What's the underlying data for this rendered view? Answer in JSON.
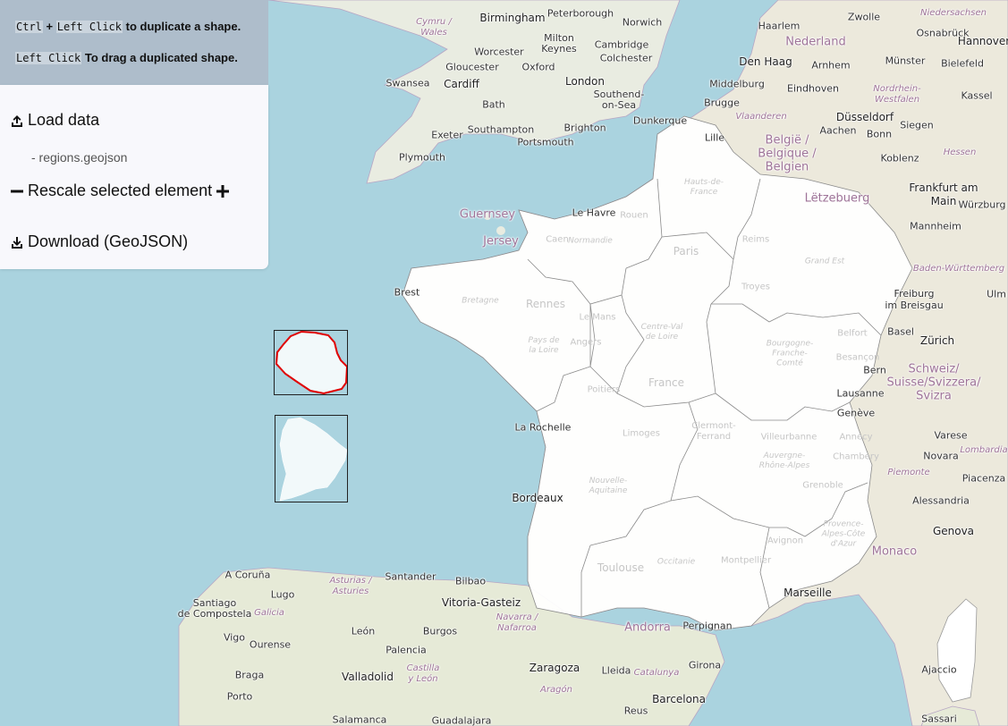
{
  "instructions": {
    "line1_key1": "Ctrl",
    "line1_plus": "+",
    "line1_key2": "Left Click",
    "line1_text": "to duplicate a shape.",
    "line2_key": "Left Click",
    "line2_text": "To drag a duplicated shape."
  },
  "panel": {
    "load_label": "Load data",
    "loaded_file": "- regions.geojson",
    "rescale_label": "Rescale selected element",
    "download_label": "Download (GeoJSON)"
  },
  "map": {
    "colors": {
      "sea": "#aad3df",
      "land": "#f1eee8",
      "overlay_fill": "#ffffff",
      "selected_stroke": "#e00000",
      "border": "#b7a6c4"
    },
    "country_labels": {
      "nederland": "Nederland",
      "belgie": "België /\nBelgique /\nBelgien",
      "letzebuerg": "Lëtzebuerg",
      "schweiz": "Schweiz/\nSuisse/Svizzera/\nSvizra",
      "andorra": "Andorra",
      "monaco": "Monaco"
    },
    "region_labels": {
      "cymru": "Cymru /\nWales",
      "vlaanderen": "Vlaanderen",
      "nordrhein": "Nordrhein-\nWestfalen",
      "hessen": "Hessen",
      "niedersachsen": "Niedersachsen",
      "baden": "Baden-Württemberg",
      "asturias": "Asturias /\nAsturies",
      "galicia": "Galicia",
      "navarra": "Navarra /\nNafarroa",
      "castilla": "Castilla\ny León",
      "catalunya": "Catalunya",
      "aragon": "Aragón",
      "piemonte": "Piemonte",
      "lombardia": "Lombardia"
    },
    "city_labels": {
      "birmingham": "Birmingham",
      "peterborough": "Peterborough",
      "norwich": "Norwich",
      "milton": "Milton\nKeynes",
      "cambridge": "Cambridge",
      "worcester": "Worcester",
      "colchester": "Colchester",
      "gloucester": "Gloucester",
      "oxford": "Oxford",
      "swansea": "Swansea",
      "cardiff": "Cardiff",
      "london": "London",
      "southend": "Southend-\non-Sea",
      "bath": "Bath",
      "exeter": "Exeter",
      "southampton": "Southampton",
      "brighton": "Brighton",
      "portsmouth": "Portsmouth",
      "plymouth": "Plymouth",
      "dunkerque": "Dunkerque",
      "guernsey": "Guernsey",
      "jersey": "Jersey",
      "lehavre": "Le Havre",
      "haarlem": "Haarlem",
      "zwolle": "Zwolle",
      "osnabruck": "Osnabrück",
      "hannover": "Hannover",
      "denhaag": "Den Haag",
      "arnhem": "Arnhem",
      "munster": "Münster",
      "bielefeld": "Bielefeld",
      "middelburg": "Middelburg",
      "eindhoven": "Eindhoven",
      "brugge": "Brugge",
      "kassel": "Kassel",
      "dusseldorf": "Düsseldorf",
      "lille": "Lille",
      "aachen": "Aachen",
      "bonn": "Bonn",
      "siegen": "Siegen",
      "koblenz": "Koblenz",
      "frankfurt": "Frankfurt am\nMain",
      "wurzburg": "Würzburg",
      "mannheim": "Mannheim",
      "freiburg": "Freiburg\nim Breisgau",
      "ulm": "Ulm",
      "zurich": "Zürich",
      "basel": "Basel",
      "bern": "Bern",
      "lausanne": "Lausanne",
      "geneve": "Genève",
      "varese": "Varese",
      "novara": "Novara",
      "piacenza": "Piacenza",
      "alessandria": "Alessandria",
      "genova": "Genova",
      "brest": "Brest",
      "larochelle": "La Rochelle",
      "bordeaux": "Bordeaux",
      "marseille": "Marseille",
      "perpignan": "Perpignan",
      "acoruna": "A Coruña",
      "santander": "Santander",
      "bilbao": "Bilbao",
      "lugo": "Lugo",
      "vitoria": "Vitoria-Gasteiz",
      "santiago": "Santiago\nde Compostela",
      "leon": "León",
      "burgos": "Burgos",
      "vigo": "Vigo",
      "ourense": "Ourense",
      "palencia": "Palencia",
      "braga": "Braga",
      "valladolid": "Valladolid",
      "zaragoza": "Zaragoza",
      "lleida": "Lleida",
      "girona": "Girona",
      "porto": "Porto",
      "barcelona": "Barcelona",
      "reus": "Reus",
      "salamanca": "Salamanca",
      "guadalajara": "Guadalajara",
      "ajaccio": "Ajaccio",
      "sassari": "Sassari"
    },
    "faint_labels": {
      "rouen": "Rouen",
      "caen": "Caen",
      "paris": "Paris",
      "reims": "Reims",
      "rennes": "Rennes",
      "lemans": "Le Mans",
      "angers": "Angers",
      "troyes": "Troyes",
      "grandest": "Grand Est",
      "france": "France",
      "poitiers": "Poitiers",
      "limoges": "Limoges",
      "clermont": "Clermont-\nFerrand",
      "villeurbanne": "Villeurbanne",
      "annecy": "Annecy",
      "chambery": "Chambéry",
      "grenoble": "Grenoble",
      "toulouse": "Toulouse",
      "montpellier": "Montpellier",
      "avignon": "Avignon",
      "belfort": "Belfort",
      "besancon": "Besançon",
      "hautsdefrance": "Hauts-de-\nFrance",
      "normandie": "Normandie",
      "bretagne": "Bretagne",
      "paysdelaloire": "Pays de\nla Loire",
      "centre": "Centre-Val\nde Loire",
      "bourgogne": "Bourgogne-\nFranche-\nComté",
      "nouvelle": "Nouvelle-\nAquitaine",
      "auvergne": "Auvergne-\nRhône-Alpes",
      "occitanie": "Occitanie",
      "provence": "Provence-\nAlpes-Côte\nd'Azur"
    }
  }
}
